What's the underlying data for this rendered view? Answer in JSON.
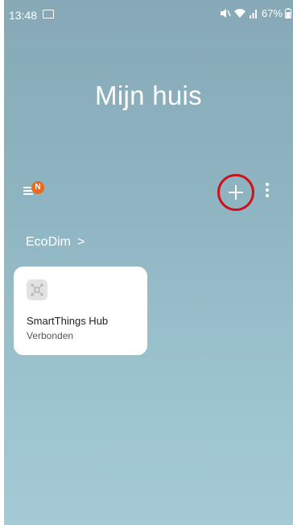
{
  "status_bar": {
    "time": "13:48",
    "battery_percent": "67%",
    "icons": [
      "image-icon",
      "mute-icon",
      "wifi-icon",
      "signal-icon",
      "battery-icon"
    ]
  },
  "header": {
    "title": "Mijn huis"
  },
  "toolbar": {
    "menu_badge": "N",
    "add_label": "+",
    "more_icon": "more-vert-icon"
  },
  "location": {
    "name": "EcoDim",
    "chevron": ">"
  },
  "devices": [
    {
      "name": "SmartThings Hub",
      "status": "Verbonden",
      "icon": "hub-icon"
    }
  ],
  "colors": {
    "background_top": "#87a9b7",
    "background_bottom": "#a3cad5",
    "badge": "#ea6a1e",
    "highlight_ring": "#d0101a",
    "card": "#ffffff"
  }
}
